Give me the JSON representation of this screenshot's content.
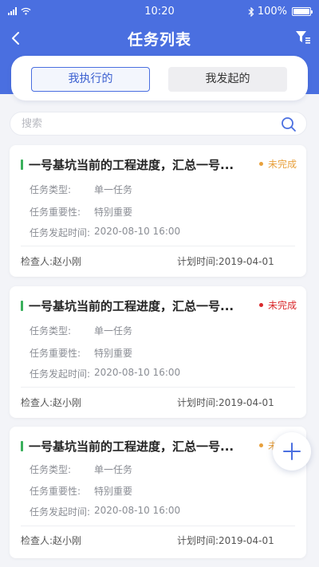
{
  "status_bar": {
    "time": "10:20",
    "battery": "100%"
  },
  "nav": {
    "title": "任务列表"
  },
  "tabs": [
    {
      "label": "我执行的",
      "active": true
    },
    {
      "label": "我发起的",
      "active": false
    }
  ],
  "search": {
    "placeholder": "搜索",
    "value": ""
  },
  "field_labels": {
    "type": "任务类型:",
    "importance": "任务重要性:",
    "issued_time": "任务发起时间:",
    "inspector": "检查人:",
    "planned_time": "计划时间:"
  },
  "tasks": [
    {
      "title": "一号基坑当前的工程进度，汇总一号...",
      "status": "未完成",
      "status_color": "#e8a03c",
      "type": "单一任务",
      "importance": "特别重要",
      "issued_time": "2020-08-10 16:00",
      "inspector": "赵小刚",
      "planned_time": "2019-04-01"
    },
    {
      "title": "一号基坑当前的工程进度，汇总一号...",
      "status": "未完成",
      "status_color": "#d9292c",
      "type": "单一任务",
      "importance": "特别重要",
      "issued_time": "2020-08-10 16:00",
      "inspector": "赵小刚",
      "planned_time": "2019-04-01"
    },
    {
      "title": "一号基坑当前的工程进度，汇总一号...",
      "status": "未完成",
      "status_color": "#e8a03c",
      "type": "单一任务",
      "importance": "特别重要",
      "issued_time": "2020-08-10 16:00",
      "inspector": "赵小刚",
      "planned_time": "2019-04-01"
    }
  ],
  "colors": {
    "accent": "#4a6fe0",
    "bar_green": "#3ab05c"
  },
  "icons": {
    "back": "chevron-left-icon",
    "filter": "filter-icon",
    "search": "search-icon",
    "add": "plus-icon"
  }
}
